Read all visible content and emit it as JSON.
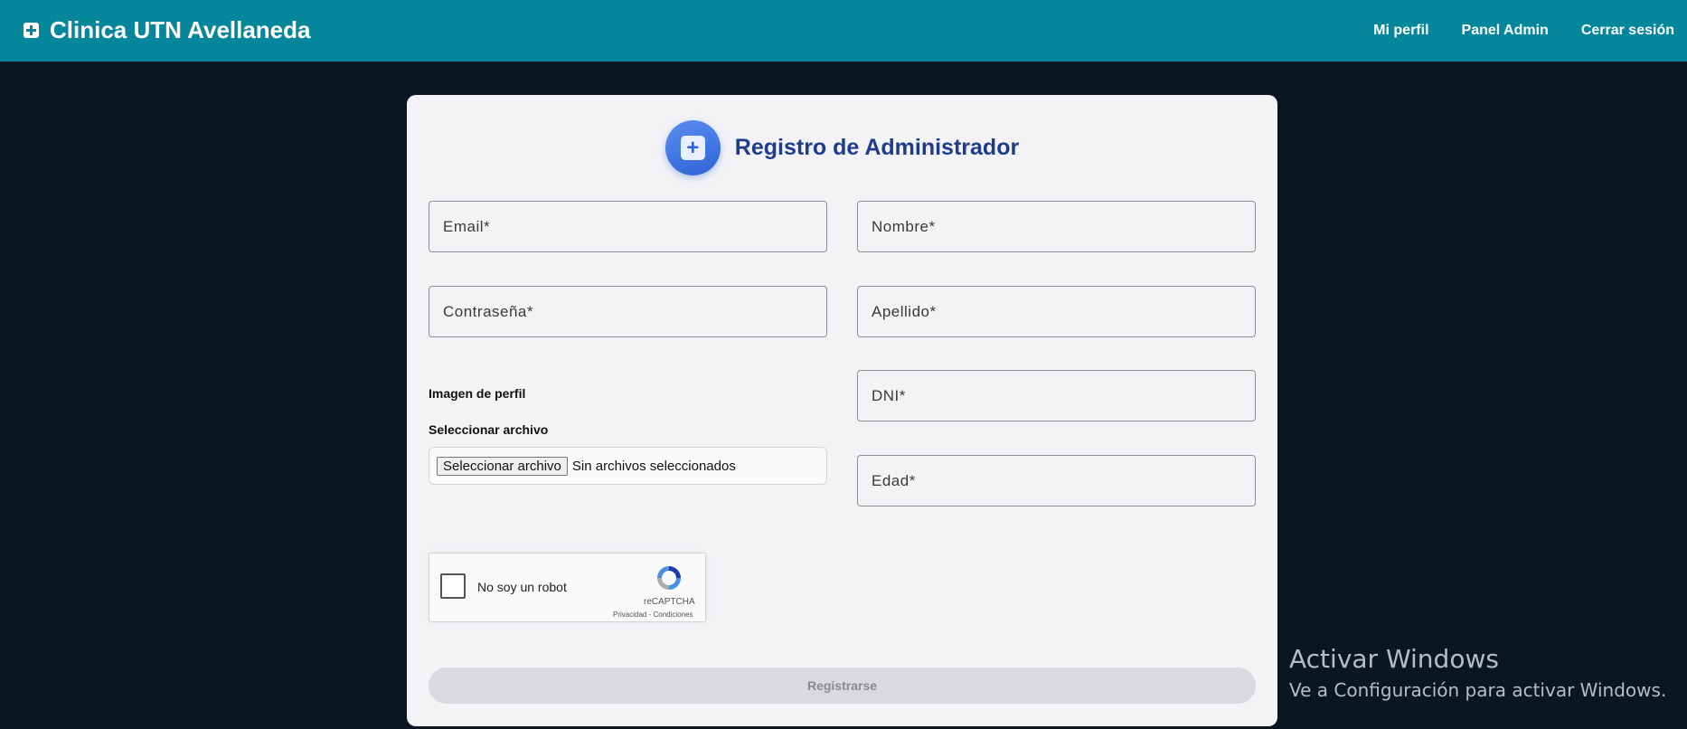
{
  "navbar": {
    "brand": "Clinica UTN Avellaneda",
    "links": [
      "Mi perfil",
      "Panel Admin",
      "Cerrar sesión"
    ]
  },
  "form": {
    "title": "Registro de Administrador",
    "fields": {
      "email": "Email*",
      "nombre": "Nombre*",
      "password": "Contraseña*",
      "apellido": "Apellido*",
      "dni": "DNI*",
      "edad": "Edad*"
    },
    "profile_image_label": "Imagen de perfil",
    "file_label": "Seleccionar archivo",
    "file_button": "Seleccionar archivo",
    "file_status": "Sin archivos seleccionados",
    "captcha": {
      "text": "No soy un robot",
      "brand": "reCAPTCHA",
      "links": "Privacidad - Condiciones"
    },
    "submit": "Registrarse"
  },
  "watermark": {
    "title": "Activar Windows",
    "subtitle": "Ve a Configuración para activar Windows."
  },
  "colors": {
    "navbar": "#06869a",
    "background": "#0b1623",
    "title": "#1f3c8c"
  }
}
